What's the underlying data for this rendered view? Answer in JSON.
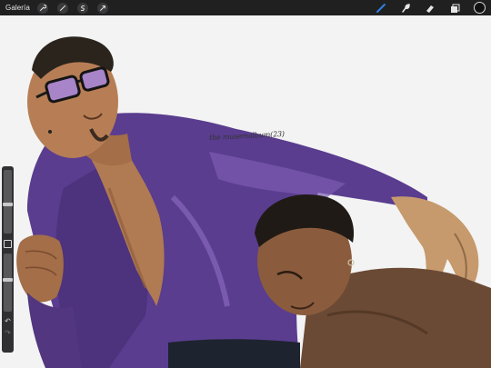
{
  "toolbar": {
    "gallery_label": "Galería",
    "left_tools": [
      {
        "icon": "wrench-icon",
        "name": "actions"
      },
      {
        "icon": "magic-wand-icon",
        "name": "adjustments"
      },
      {
        "icon": "selection-icon",
        "name": "selection"
      },
      {
        "icon": "transform-arrow-icon",
        "name": "transform"
      }
    ],
    "right_tools": [
      {
        "icon": "brush-icon",
        "name": "paint",
        "active": true
      },
      {
        "icon": "smudge-icon",
        "name": "smudge"
      },
      {
        "icon": "eraser-icon",
        "name": "eraser"
      },
      {
        "icon": "layers-icon",
        "name": "layers"
      }
    ],
    "active_color": "#111111",
    "accent_color": "#2f7fe3"
  },
  "canvas": {
    "signature_text": "the musemalbum(23)",
    "artwork": "digital painting of two men; one in glasses and a purple shirt, one in a brown shirt"
  },
  "sidebar": {
    "brush_size": 0.45,
    "brush_opacity": 0.55,
    "undo_label": "↶",
    "redo_label": "↷"
  }
}
